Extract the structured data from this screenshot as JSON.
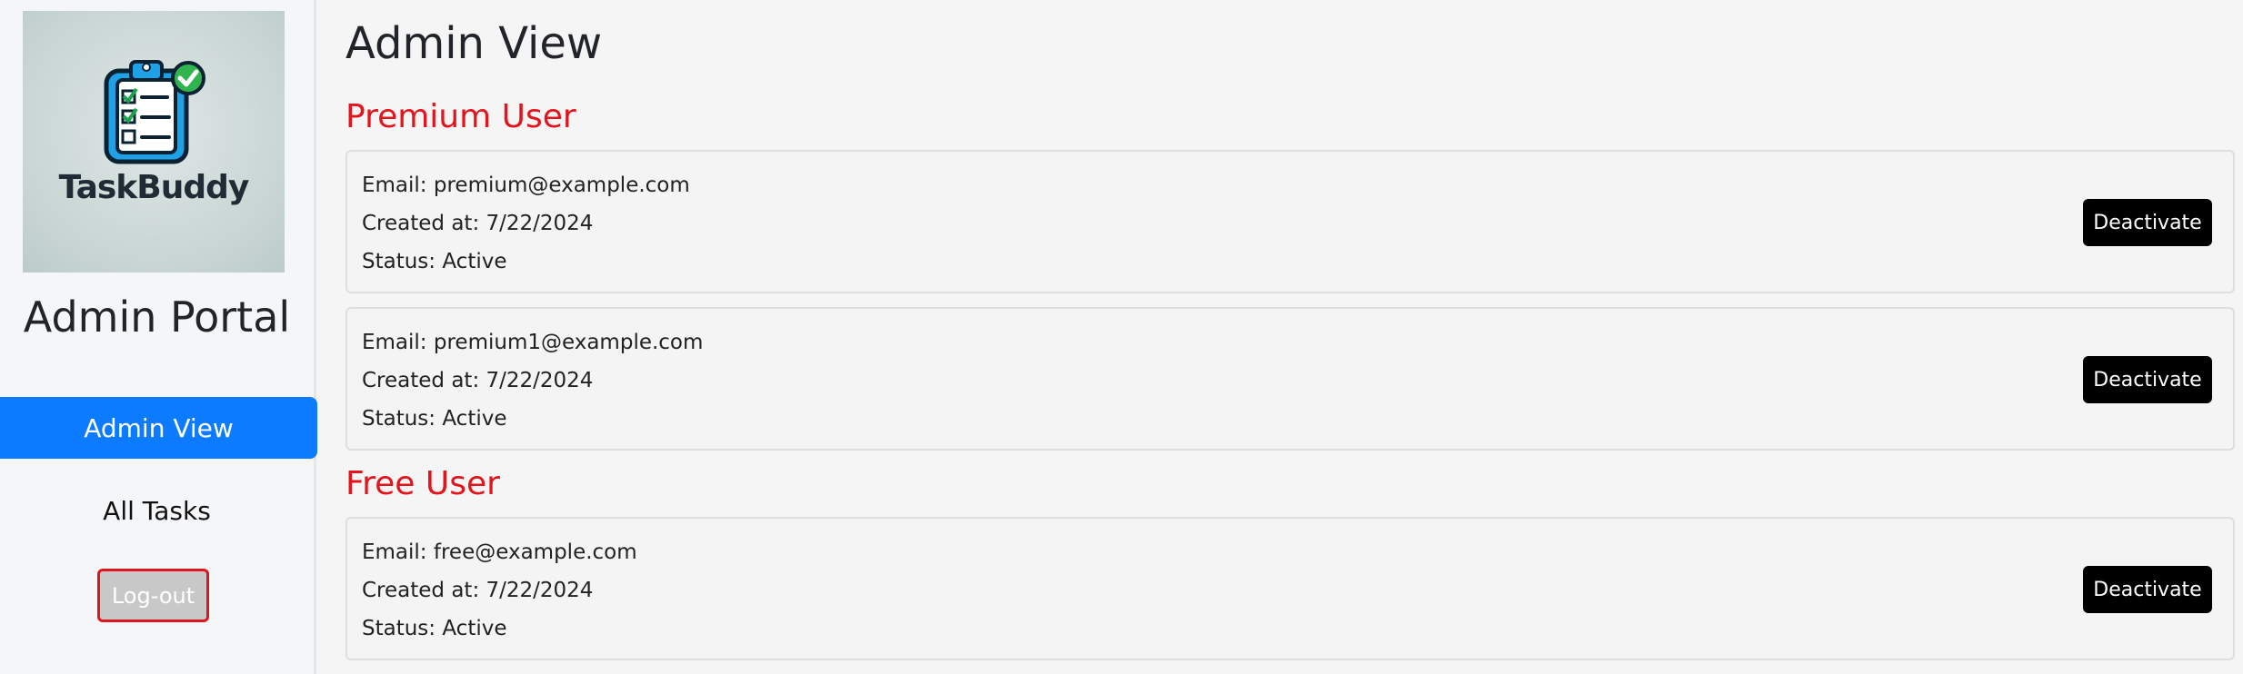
{
  "sidebar": {
    "logo_text": "TaskBuddy",
    "portal_title": "Admin Portal",
    "nav": {
      "admin_view": "Admin View",
      "all_tasks": "All Tasks",
      "logout": "Log-out"
    }
  },
  "main": {
    "title": "Admin View",
    "premium_section": {
      "heading": "Premium User",
      "users": [
        {
          "email": "Email: premium@example.com",
          "created": "Created at: 7/22/2024",
          "status": "Status: Active",
          "action": "Deactivate"
        },
        {
          "email": "Email: premium1@example.com",
          "created": "Created at: 7/22/2024",
          "status": "Status: Active",
          "action": "Deactivate"
        }
      ]
    },
    "free_section": {
      "heading": "Free User",
      "users": [
        {
          "email": "Email: free@example.com",
          "created": "Created at: 7/22/2024",
          "status": "Status: Active",
          "action": "Deactivate"
        }
      ]
    }
  },
  "colors": {
    "accent_blue": "#0d7bff",
    "section_red": "#e3141c",
    "button_black": "#000000",
    "logout_border": "#e0141e"
  },
  "icons": {
    "logo": "clipboard-checklist-icon"
  }
}
